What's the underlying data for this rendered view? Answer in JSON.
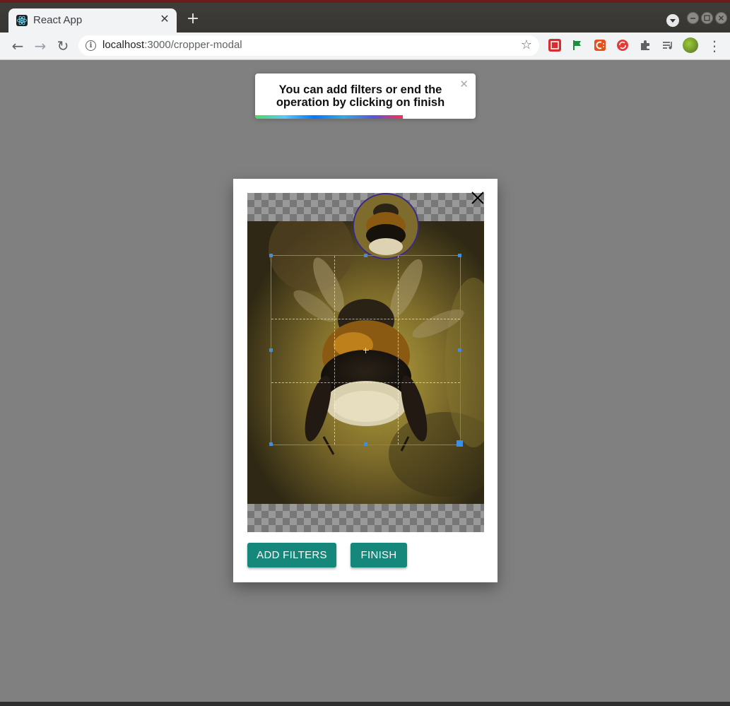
{
  "browser": {
    "tab_title": "React App",
    "tab_close": "✕",
    "new_tab": "+",
    "url_host": "localhost",
    "url_path": ":3000/cropper-modal",
    "icons": {
      "back": "←",
      "forward": "→",
      "reload": "↻",
      "info": "i",
      "star": "☆",
      "menu": "⋮"
    }
  },
  "toast": {
    "message": "You can add filters or end the operation by clicking on finish",
    "close": "✕",
    "progress": 0.67
  },
  "modal": {
    "add_filters_label": "ADD FILTERS",
    "finish_label": "FINISH"
  },
  "colors": {
    "accent": "#16877b",
    "crop_border": "#3b8fe8",
    "preview_border": "#3a2b8a"
  }
}
